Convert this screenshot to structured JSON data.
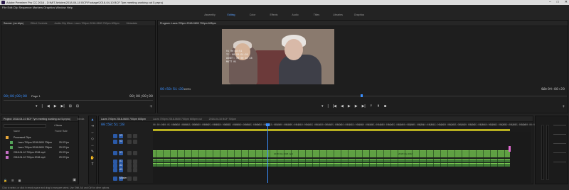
{
  "window": {
    "title": "Adobe Premiere Pro CC 2016 - D:\\MIT Articles\\2018-04-10 BCF\\Footage\\2018-04-10 BCF Tym meeting working cut 5.prproj",
    "controls": [
      "–",
      "□",
      "✕"
    ]
  },
  "menu": {
    "items_text": "File  Edit  Clip  Sequence  Markers  Graphics  Window  Help"
  },
  "workspaces": {
    "tabs": [
      "Assembly",
      "Editing",
      "Color",
      "Effects",
      "Audio",
      "Titles",
      "Libraries",
      "Graphics"
    ],
    "active": "Editing"
  },
  "source_panel": {
    "tabs": [
      "Source: (no clips)",
      "Effect Controls",
      "Audio Clip Mixer: Lacrs 700pm 2018-0600 700pm 605pm",
      "Metadata"
    ],
    "timecode_in": "00;00;00;00",
    "page": "Page 1",
    "timecode_out": "00;00;00;00"
  },
  "program_panel": {
    "tab": "Program: Lacrs 700pm 2018-0600 700pm 605pm",
    "timecode": "00:58:51:28",
    "zoom": "100%",
    "quality": "1/2",
    "duration": "03:04:88:20",
    "overlay_lines": [
      "V1 00:58:51",
      "TC: 00:58:51:28",
      "ASSET: 00 00 10 48",
      "MATT 01"
    ]
  },
  "project_panel": {
    "tabs": [
      "Project: 2018-04-10 BCF Tym meeting working cut 5.prproj",
      "Media"
    ],
    "search_placeholder": "",
    "items_count": "4 Items",
    "columns": [
      "Name",
      "Frame Rate"
    ],
    "items": [
      {
        "name": "Processed Clips",
        "rate": "",
        "color": "#e8a83a"
      },
      {
        "name": "Lacrs 700pm 2018-0600 700pm",
        "rate": "29.97 fps",
        "color": "#55a55a"
      },
      {
        "name": "Lacrs 700pm 2018-0600 700pm",
        "rate": "29.97 fps",
        "color": "#55a55a"
      },
      {
        "name": "2018-04-10 700pm 2018 mp4",
        "rate": "29.97 fps",
        "color": "#c46ec4"
      },
      {
        "name": "2018-04-10 700pm 2018 mp4",
        "rate": "29.97 fps",
        "color": "#c46ec4"
      }
    ]
  },
  "timeline": {
    "tabs": [
      "Lacrs 700pm 2018-0600 700pm 605pm",
      "Lacrs 700pm 2018-0600 700pm 605pm cut",
      "2018-04-10 BCF 700pm"
    ],
    "timecode": "00:58:51:28",
    "ruler": [
      "00:00:00",
      "00:05:00:00",
      "00:10:00:00",
      "00:15:00:00",
      "00:20:00:00",
      "00:25:00:00",
      "00:30:00:00",
      "00:35:00:00",
      "00:40:00:00",
      "00:45:00:00",
      "00:50:00:00",
      "00:55:00:00",
      "01:00:00:00",
      "01:05:00:00",
      "01:10:00:00",
      "01:15:00:00",
      "01:20:00:00",
      "01:25:00:00",
      "01:30:00:00",
      "01:35:00:00",
      "01:40:00:00",
      "01:45:00:00",
      "01:50:00:00",
      "01:55:00:00",
      "02:00:00:00",
      "02:05:00:00",
      "02:10:00:00",
      "02:15:00:00",
      "02:20:00:00",
      "02:25:00:00",
      "02:30:00:00",
      "02:35:00:00",
      "02:40:00:00",
      "02:45:00:00",
      "02:50:00:00",
      "02:55:00:00",
      "03:00:00:00"
    ],
    "tracks": [
      "V3",
      "V2",
      "V1",
      "A1",
      "A2",
      "A3",
      "Master"
    ],
    "master_value": "0.0",
    "clip_label_1": "2018 Clip 2018 mp4",
    "clip_label_2": "2018 Clip 2018"
  },
  "status": "Click to select, or click in empty space and drag to marquee select. Use Shift, Alt, and Ctrl for other options."
}
